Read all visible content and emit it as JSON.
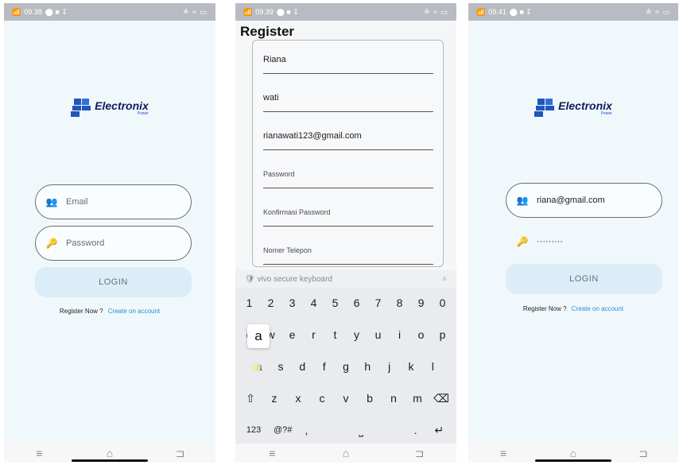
{
  "status": {
    "s1": {
      "time": "09.38",
      "right": "≗ ≈ ▭"
    },
    "s2": {
      "time": "09.39",
      "right": "≗ ≈ ▭"
    },
    "s3": {
      "time": "09.41",
      "right": "≗ ≈ ▭"
    }
  },
  "logo": {
    "title": "Electronix",
    "subtitle": "Power"
  },
  "login1": {
    "email_placeholder": "Email",
    "password_placeholder": "Password",
    "login_label": "LOGIN",
    "register_prompt": "Register Now ?",
    "register_link": "Create on account"
  },
  "register": {
    "title": "Register",
    "fields": [
      {
        "value": "Riana"
      },
      {
        "value": "wati"
      },
      {
        "value": "rianawati123@gmail.com"
      },
      {
        "placeholder": "Password"
      },
      {
        "placeholder": "Konfirmasi Password"
      },
      {
        "placeholder": "Nomer Telepon"
      }
    ]
  },
  "keyboard": {
    "bar_label": "vivo secure keyboard",
    "row_numbers": [
      "1",
      "2",
      "3",
      "4",
      "5",
      "6",
      "7",
      "8",
      "9",
      "0"
    ],
    "row_top": [
      "q",
      "w",
      "e",
      "r",
      "t",
      "y",
      "u",
      "i",
      "o",
      "p"
    ],
    "row_mid": [
      "a",
      "s",
      "d",
      "f",
      "g",
      "h",
      "j",
      "k",
      "l"
    ],
    "row_bottom": [
      "z",
      "x",
      "c",
      "v",
      "b",
      "n",
      "m"
    ],
    "key_123": "123",
    "key_sym": "@?#",
    "key_comma": ",",
    "key_period": ".",
    "popup_letter": "a"
  },
  "login3": {
    "email_value": "riana@gmail.com",
    "password_value": "·········",
    "login_label": "LOGIN",
    "register_prompt": "Register Now ?",
    "register_link": "Create on account"
  }
}
